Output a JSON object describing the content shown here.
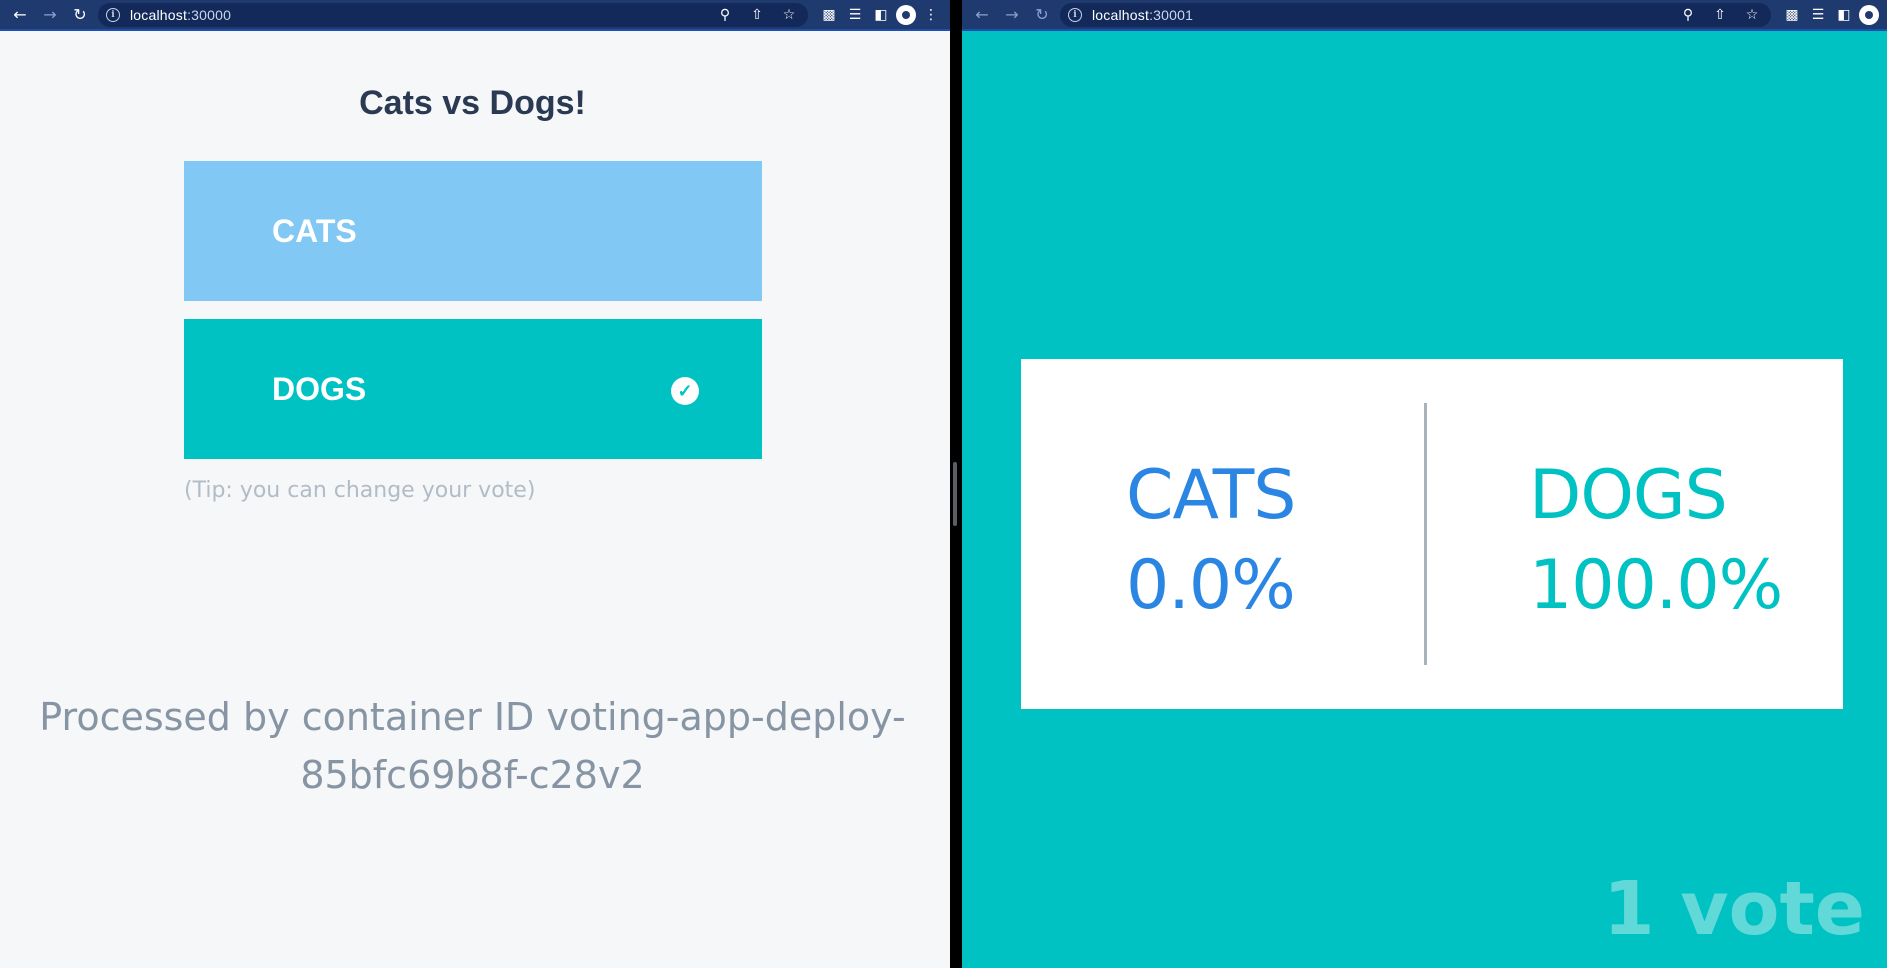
{
  "left_window": {
    "url_host": "localhost",
    "url_port": ":30000",
    "vote_page": {
      "title": "Cats vs Dogs!",
      "option_a": "CATS",
      "option_b": "DOGS",
      "selected": "DOGS",
      "tip": "(Tip: you can change your vote)",
      "processed_by": "Processed by container ID voting-app-deploy-85bfc69b8f-c28v2"
    }
  },
  "right_window": {
    "url_host": "localhost",
    "url_port": ":30001",
    "result_page": {
      "option_a": "CATS",
      "option_a_percent": "0.0%",
      "option_b": "DOGS",
      "option_b_percent": "100.0%",
      "vote_count": "1 vote"
    }
  },
  "colors": {
    "browser_toolbar": "#1e3a6e",
    "cats_button": "#82c8f5",
    "dogs_button": "#00c2c2",
    "cats_result": "#2b86e3",
    "dogs_result": "#00c2c2",
    "result_background": "#00c2c2"
  },
  "icons": {
    "back": "back-arrow-icon",
    "forward": "forward-arrow-icon",
    "reload": "reload-icon",
    "site_info": "info-icon",
    "zoom": "zoom-icon",
    "share": "share-icon",
    "bookmark": "star-icon",
    "extensions": "puzzle-icon",
    "reading_list": "reading-list-icon",
    "side_panel": "side-panel-icon",
    "profile": "avatar-icon",
    "menu": "kebab-menu-icon",
    "selected": "check-circle-icon"
  }
}
